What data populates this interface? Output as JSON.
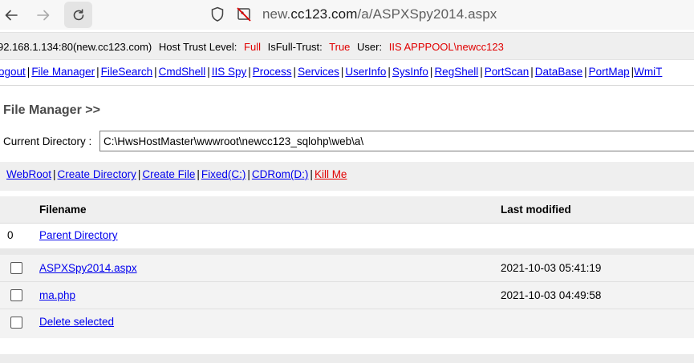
{
  "browser": {
    "url_prefix": "new.",
    "url_host": "cc123.com",
    "url_path": "/a/ASPXSpy2014.aspx"
  },
  "info": {
    "host": "92.168.1.134:80(new.cc123.com)",
    "trust_label": "Host Trust Level:",
    "trust_value": "Full",
    "fulltrust_label": "IsFull-Trust:",
    "fulltrust_value": "True",
    "user_label": "User:",
    "user_value": "IIS APPPOOL\\newcc123"
  },
  "menu": [
    "ogout",
    "File Manager",
    "FileSearch",
    "CmdShell",
    "IIS Spy",
    "Process",
    "Services",
    "UserInfo",
    "SysInfo",
    "RegShell",
    "PortScan",
    "DataBase",
    "PortMap",
    "WmiT"
  ],
  "file_manager": {
    "title": "File Manager >>",
    "current_dir_label": "Current Directory :",
    "current_dir_value": "C:\\HwsHostMaster\\wwwroot\\newcc123_sqlohp\\web\\a\\",
    "actions": [
      "WebRoot",
      "Create Directory",
      "Create File",
      "Fixed(C:)",
      "CDRom(D:)"
    ],
    "kill_label": "Kill Me",
    "columns": {
      "filename": "Filename",
      "last_modified": "Last modified"
    },
    "parent": {
      "index": "0",
      "label": "Parent Directory"
    },
    "files": [
      {
        "name": "ASPXSpy2014.aspx",
        "modified": "2021-10-03 05:41:19"
      },
      {
        "name": "ma.php",
        "modified": "2021-10-03 04:49:58"
      }
    ],
    "delete_label": "Delete selected"
  }
}
